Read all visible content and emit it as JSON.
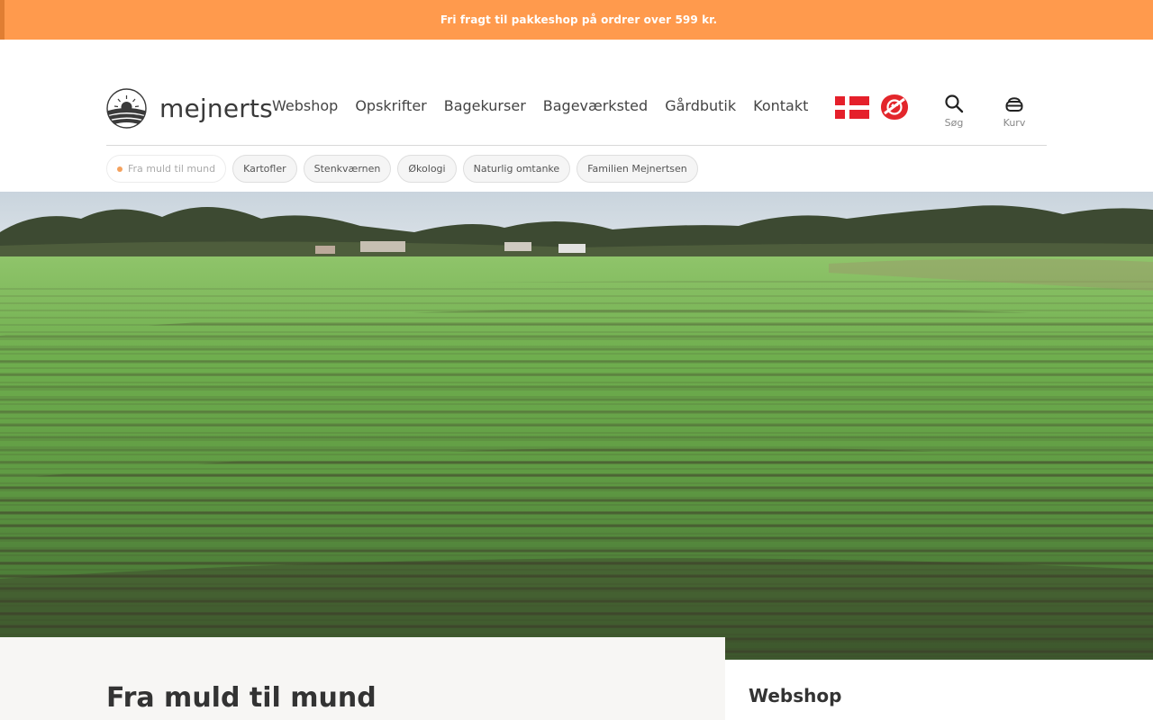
{
  "promo": {
    "text": "Fri fragt til pakkeshop på ordrer over 599 kr."
  },
  "logo": {
    "text": "mejnerts"
  },
  "nav": {
    "items": [
      {
        "label": "Webshop"
      },
      {
        "label": "Opskrifter"
      },
      {
        "label": "Bagekurser"
      },
      {
        "label": "Bageværksted"
      },
      {
        "label": "Gårdbutik"
      },
      {
        "label": "Kontakt"
      }
    ]
  },
  "icons": {
    "search": {
      "name": "search-icon",
      "label": "Søg"
    },
    "cart": {
      "name": "cart-icon",
      "label": "Kurv"
    }
  },
  "chips": {
    "items": [
      {
        "label": "Fra muld til mund",
        "active": true
      },
      {
        "label": "Kartofler"
      },
      {
        "label": "Stenkværnen"
      },
      {
        "label": "Økologi"
      },
      {
        "label": "Naturlig omtanke"
      },
      {
        "label": "Familien Mejnertsen"
      }
    ]
  },
  "page": {
    "title": "Fra muld til mund"
  },
  "sidebar": {
    "title": "Webshop"
  },
  "colors": {
    "promo_bg": "#ff9a4d",
    "accent_dot": "#f4a15d",
    "flag_red": "#e5202b",
    "seal_red": "#e3262b"
  }
}
